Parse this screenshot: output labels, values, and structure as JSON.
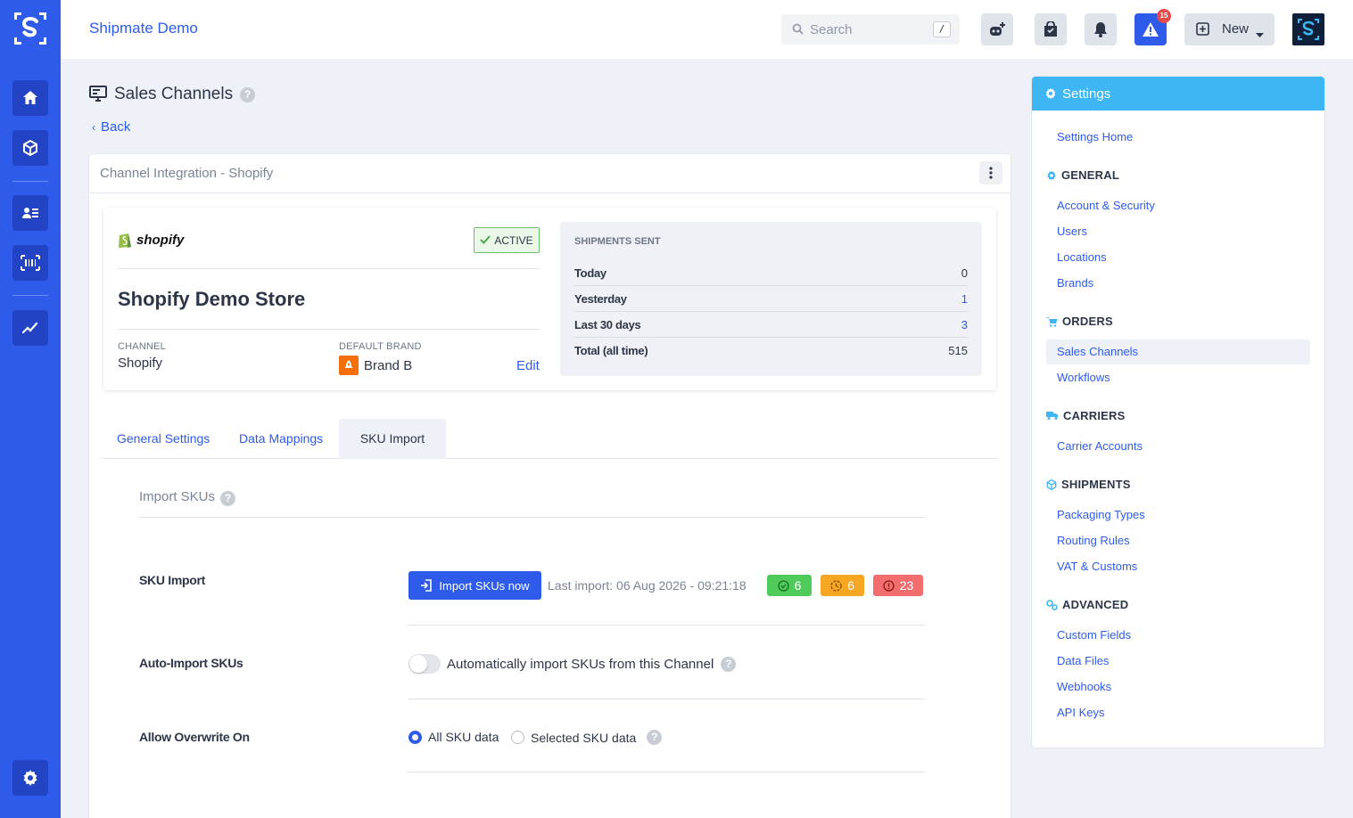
{
  "header": {
    "app_title": "Shipmate Demo",
    "search_placeholder": "Search",
    "search_shortcut": "/",
    "alert_count": "15",
    "new_label": "New"
  },
  "page": {
    "title": "Sales Channels",
    "back_label": "Back",
    "card_title": "Channel Integration - Shopify"
  },
  "store": {
    "logo_text": "shopify",
    "status": "ACTIVE",
    "name": "Shopify Demo Store",
    "channel_label": "CHANNEL",
    "channel_value": "Shopify",
    "brand_label": "DEFAULT BRAND",
    "brand_value": "Brand B",
    "edit_label": "Edit"
  },
  "shipments": {
    "title": "SHIPMENTS SENT",
    "rows": [
      {
        "label": "Today",
        "value": "0"
      },
      {
        "label": "Yesterday",
        "value": "1"
      },
      {
        "label": "Last 30 days",
        "value": "3"
      },
      {
        "label": "Total (all time)",
        "value": "515"
      }
    ]
  },
  "tabs": [
    {
      "label": "General Settings"
    },
    {
      "label": "Data Mappings"
    },
    {
      "label": "SKU Import"
    }
  ],
  "sku": {
    "section_title": "Import SKUs",
    "import_label": "SKU Import",
    "import_button": "Import SKUs now",
    "last_import": "Last import: 06 Aug 2026 - 09:21:18",
    "counts": {
      "success": "6",
      "pending": "6",
      "error": "23"
    },
    "auto_label": "Auto-Import SKUs",
    "auto_text": "Automatically import SKUs from this Channel",
    "auto_enabled": false,
    "overwrite_label": "Allow Overwrite On",
    "overwrite_options": [
      "All SKU data",
      "Selected SKU data"
    ],
    "overwrite_selected": "All SKU data"
  },
  "settings": {
    "title": "Settings",
    "home": "Settings Home",
    "sections": [
      {
        "title": "GENERAL",
        "items": [
          "Account & Security",
          "Users",
          "Locations",
          "Brands"
        ]
      },
      {
        "title": "ORDERS",
        "items": [
          "Sales Channels",
          "Workflows"
        ]
      },
      {
        "title": "CARRIERS",
        "items": [
          "Carrier Accounts"
        ]
      },
      {
        "title": "SHIPMENTS",
        "items": [
          "Packaging Types",
          "Routing Rules",
          "VAT & Customs"
        ]
      },
      {
        "title": "ADVANCED",
        "items": [
          "Custom Fields",
          "Data Files",
          "Webhooks",
          "API Keys"
        ]
      }
    ],
    "active_item": "Sales Channels"
  },
  "colors": {
    "primary": "#2f5bea",
    "rail": "#2f5bea",
    "settings_header": "#3fb6f4",
    "success": "#4ecb5a",
    "warning": "#f5a623",
    "danger": "#f26d6d",
    "brand": "#f5700a"
  },
  "icons": [
    "logo-icon",
    "home-icon",
    "package-icon",
    "contacts-icon",
    "barcode-icon",
    "chart-icon",
    "gear-icon",
    "search-icon",
    "robot-icon",
    "bag-icon",
    "bell-icon",
    "alert-icon",
    "plus-icon",
    "caret-down-icon",
    "monitor-icon",
    "help-icon",
    "chevron-left-icon",
    "kebab-icon",
    "check-icon",
    "import-icon",
    "clock-icon",
    "error-icon",
    "cart-icon",
    "truck-icon",
    "cube-icon",
    "cogs-icon"
  ]
}
